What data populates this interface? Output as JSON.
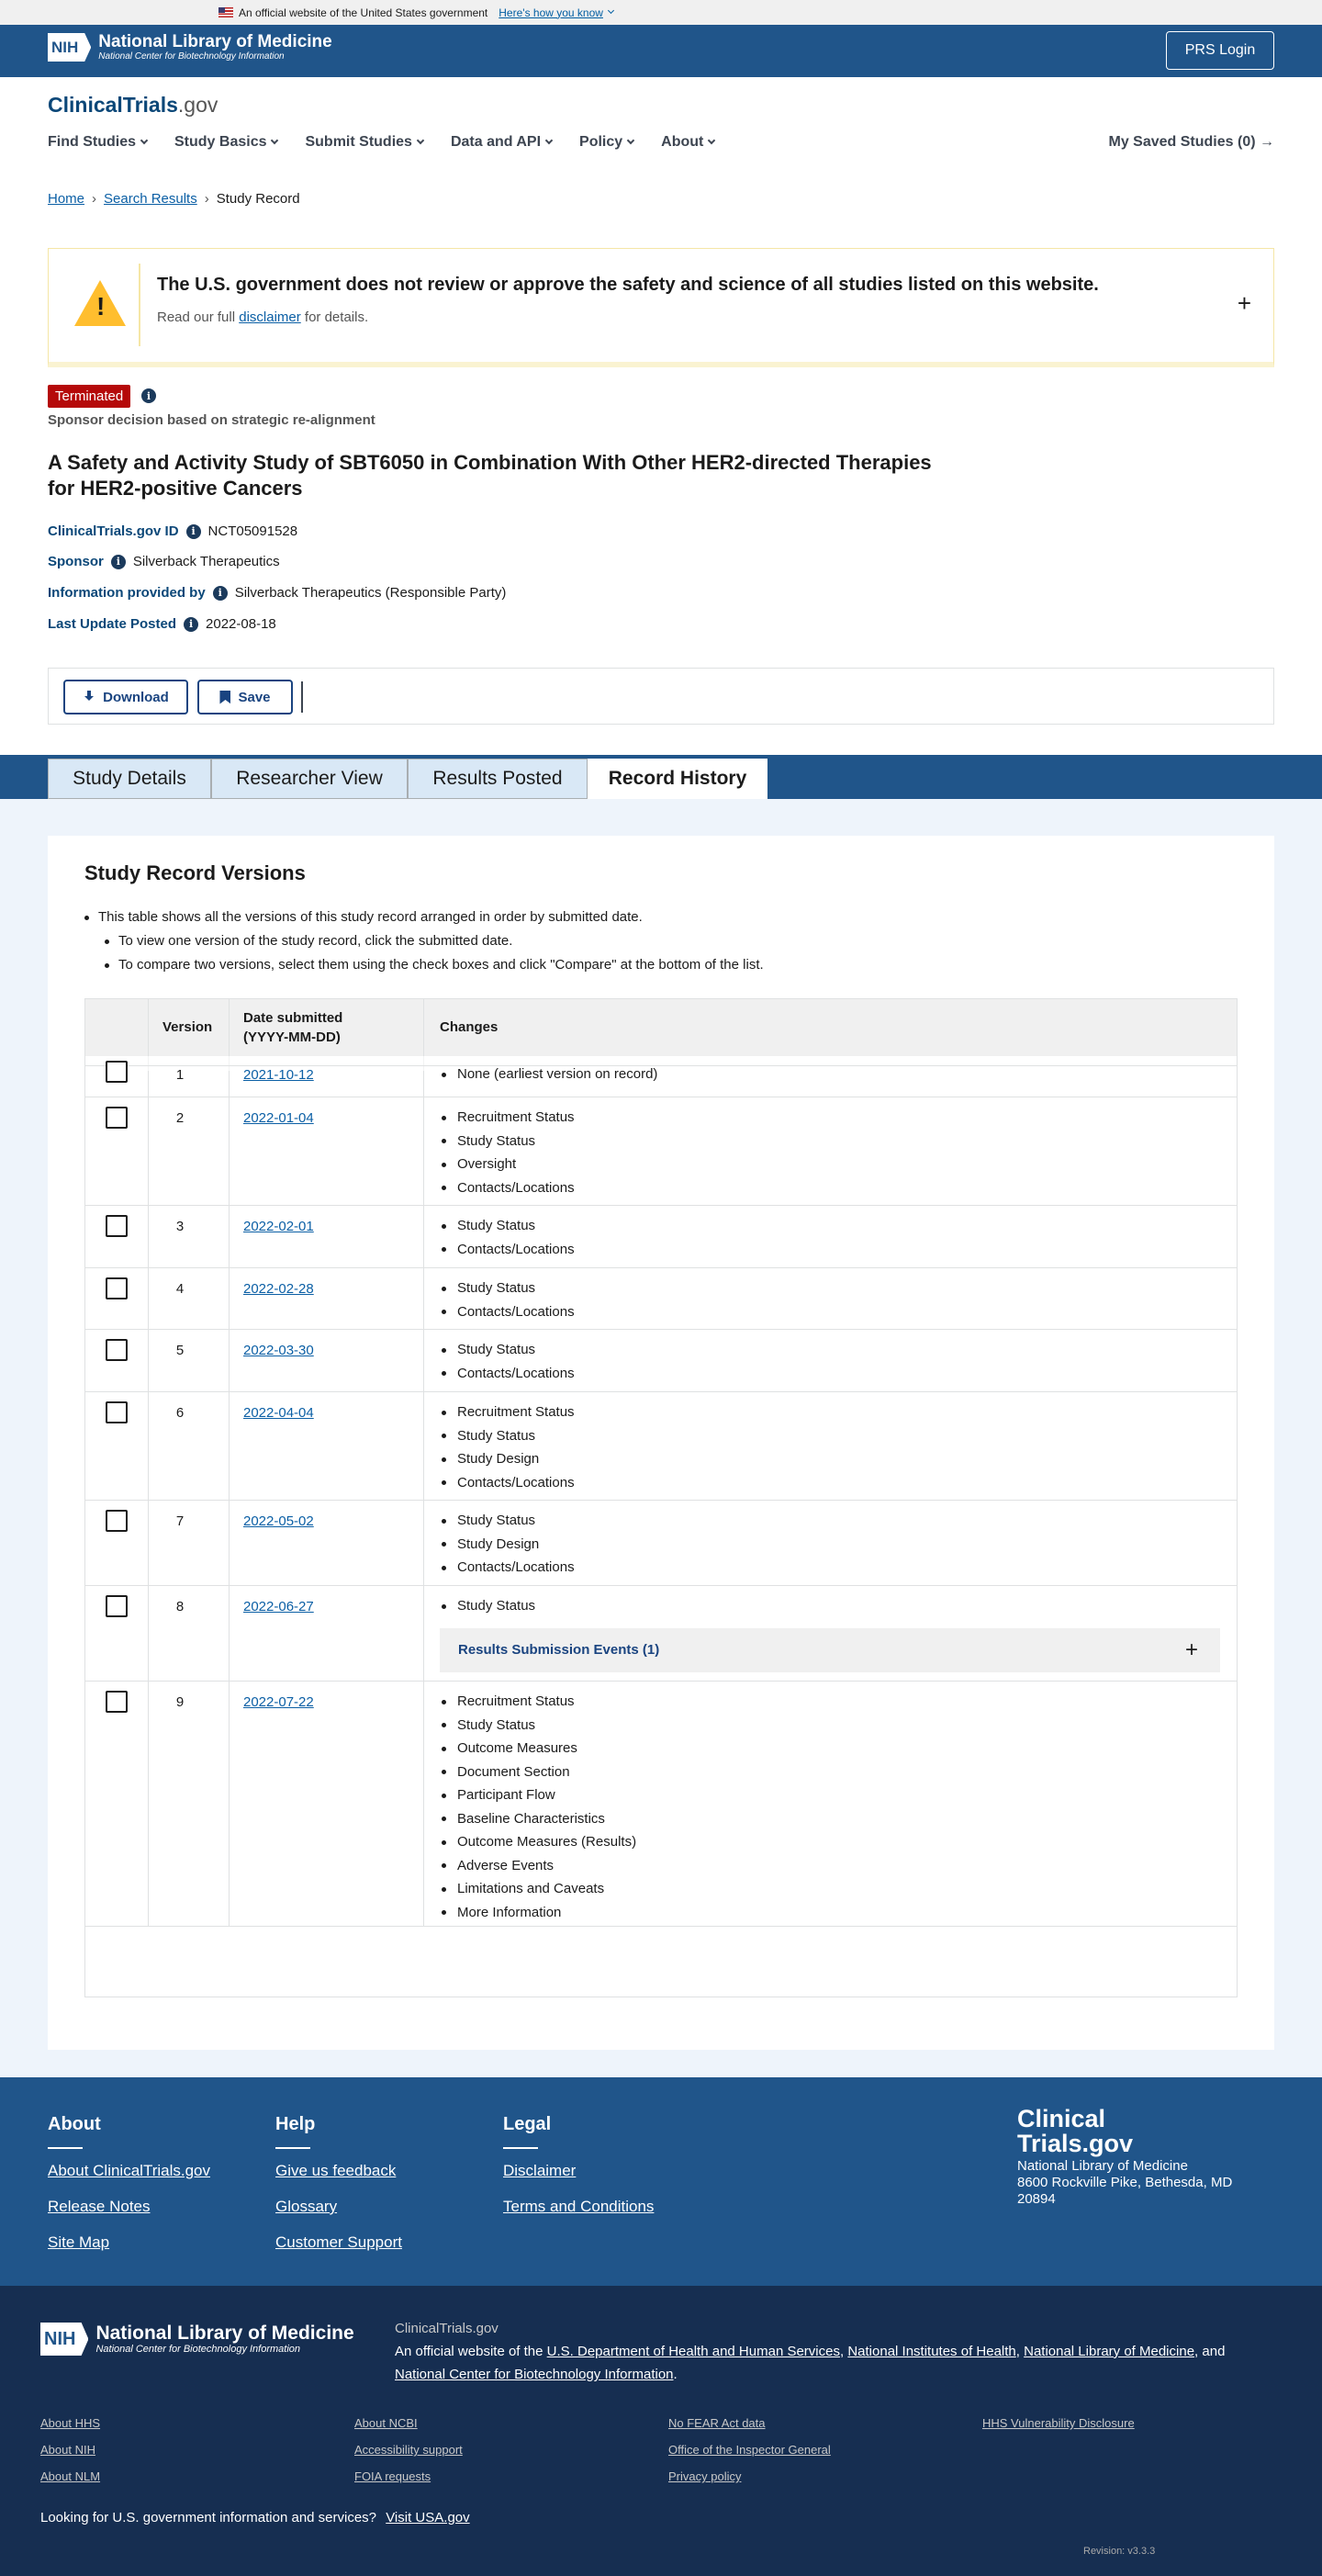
{
  "gov_banner": {
    "text": "An official website of the United States government",
    "link": "Here's how you know"
  },
  "header": {
    "nih": "NIH",
    "org": "National Library of Medicine",
    "org_sub": "National Center for Biotechnology Information",
    "prs": "PRS Login",
    "site_a": "ClinicalTrials",
    "site_b": ".gov",
    "nav": [
      "Find Studies",
      "Study Basics",
      "Submit Studies",
      "Data and API",
      "Policy",
      "About"
    ],
    "saved": "My Saved Studies (0)"
  },
  "breadcrumb": [
    "Home",
    "Search Results",
    "Study Record"
  ],
  "notice": {
    "title": "The U.S. government does not review or approve the safety and science of all studies listed on this website.",
    "pre": "Read our full",
    "link": "disclaimer",
    "post": "for details.",
    "toggle": "+"
  },
  "study": {
    "status": "Terminated",
    "reason": "Sponsor decision based on strategic re-alignment",
    "title": "A Safety and Activity Study of SBT6050 in Combination With Other HER2-directed Therapies for HER2-positive Cancers",
    "id_label": "ClinicalTrials.gov ID",
    "id": "NCT05091528",
    "sponsor_label": "Sponsor",
    "sponsor": "Silverback Therapeutics",
    "provided_label": "Information provided by",
    "provided": "Silverback Therapeutics (Responsible Party)",
    "updated_label": "Last Update Posted",
    "updated": "2022-08-18"
  },
  "actions": {
    "download": "Download",
    "save": "Save"
  },
  "tabs": [
    "Study Details",
    "Researcher View",
    "Results Posted",
    "Record History"
  ],
  "versions": {
    "heading": "Study Record Versions",
    "bullets": [
      "This table shows all the versions of this study record arranged in order by submitted date.",
      "To view one version of the study record, click the submitted date.",
      "To compare two versions, select them using the check boxes and click \"Compare\" at the bottom of the list."
    ],
    "columns": [
      "Version",
      "Date submitted",
      "(YYYY-MM-DD)",
      "Changes"
    ],
    "rows": [
      {
        "v": "1",
        "date": "2021-10-12",
        "changes": [
          "None (earliest version on record)"
        ]
      },
      {
        "v": "2",
        "date": "2022-01-04",
        "changes": [
          "Recruitment Status",
          "Study Status",
          "Oversight",
          "Contacts/Locations"
        ]
      },
      {
        "v": "3",
        "date": "2022-02-01",
        "changes": [
          "Study Status",
          "Contacts/Locations"
        ]
      },
      {
        "v": "4",
        "date": "2022-02-28",
        "changes": [
          "Study Status",
          "Contacts/Locations"
        ]
      },
      {
        "v": "5",
        "date": "2022-03-30",
        "changes": [
          "Study Status",
          "Contacts/Locations"
        ]
      },
      {
        "v": "6",
        "date": "2022-04-04",
        "changes": [
          "Recruitment Status",
          "Study Status",
          "Study Design",
          "Contacts/Locations"
        ]
      },
      {
        "v": "7",
        "date": "2022-05-02",
        "changes": [
          "Study Status",
          "Study Design",
          "Contacts/Locations"
        ]
      },
      {
        "v": "8",
        "date": "2022-06-27",
        "changes": [
          "Study Status"
        ],
        "accordion": "Results Submission Events (1)"
      },
      {
        "v": "9",
        "date": "2022-07-22",
        "changes": [
          "Recruitment Status",
          "Study Status",
          "Outcome Measures",
          "Document Section",
          "Participant Flow",
          "Baseline Characteristics",
          "Outcome Measures (Results)",
          "Adverse Events",
          "Limitations and Caveats",
          "More Information"
        ]
      }
    ]
  },
  "footer": {
    "about": {
      "h": "About",
      "links": [
        "About ClinicalTrials.gov",
        "Release Notes",
        "Site Map"
      ]
    },
    "help": {
      "h": "Help",
      "links": [
        "Give us feedback",
        "Glossary",
        "Customer Support"
      ]
    },
    "legal": {
      "h": "Legal",
      "links": [
        "Disclaimer",
        "Terms and Conditions"
      ]
    },
    "logo_a": "Clinical",
    "logo_b": "Trials.gov",
    "addr": [
      "National Library of Medicine",
      "8600 Rockville Pike, Bethesda, MD",
      "20894"
    ]
  },
  "footer2": {
    "site": "ClinicalTrials.gov",
    "official": "An official website of the",
    "hhs": "U.S. Department of Health and Human Services",
    "nih": "National Institutes of Health",
    "nlm": "National Library of Medicine",
    "and": "and",
    "ncbi": "National Center for Biotechnology Information",
    "links": [
      "About HHS",
      "About NIH",
      "About NLM",
      "About NCBI",
      "Accessibility support",
      "FOIA requests",
      "No FEAR Act data",
      "Office of the Inspector General",
      "Privacy policy",
      "HHS Vulnerability Disclosure"
    ],
    "lookfor": "Looking for U.S. government information and services?",
    "usa": "Visit USA.gov",
    "revision": "Revision: v3.3.3"
  }
}
